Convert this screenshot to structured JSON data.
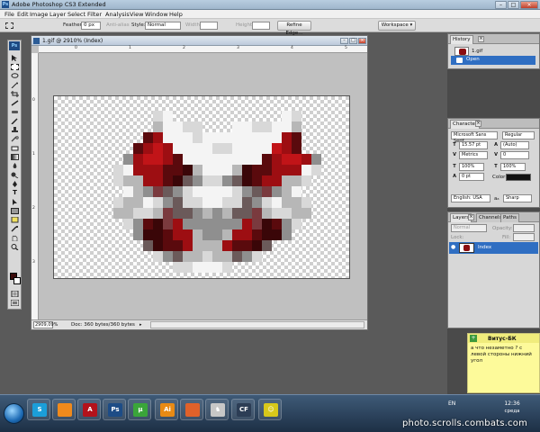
{
  "window": {
    "title": "Adobe Photoshop CS3 Extended",
    "controls": {
      "minimize": "–",
      "maximize": "□",
      "close": "×"
    }
  },
  "menu": [
    "File",
    "Edit",
    "Image",
    "Layer",
    "Select",
    "Filter",
    "Analysis",
    "View",
    "Window",
    "Help"
  ],
  "options_bar": {
    "feather_label": "Feather:",
    "feather_value": "0 px",
    "antialias_label": "Anti-alias",
    "style_label": "Style:",
    "style_value": "Normal",
    "width_label": "Width:",
    "height_label": "Height:",
    "refine_edge": "Refine Edge...",
    "workspace": "Workspace ▾"
  },
  "toolbox": {
    "logo": "Ps"
  },
  "document": {
    "title": "1.gif @ 2910% (Index)",
    "zoom": "2909,09%",
    "doc_info": "Doc: 360 bytes/360 bytes",
    "status_arrow": "▸"
  },
  "history_panel": {
    "tab": "History",
    "close": "×",
    "snapshot": "1.gif",
    "step": "Open"
  },
  "character_panel": {
    "tab": "Character",
    "close": "×",
    "font_family": "Microsoft Sans Serif",
    "font_style": "Regular",
    "font_size": "15.57 pt",
    "leading": "(Auto)",
    "kerning": "Metrics",
    "tracking": "0",
    "vscale": "100%",
    "hscale": "100%",
    "baseline": "0 pt",
    "color_label": "Color:",
    "language": "English: USA",
    "antialias": "Sharp",
    "aa_prefix": "aₐ"
  },
  "layers_panel": {
    "tabs": [
      "Layers",
      "Channels",
      "Paths"
    ],
    "close": "×",
    "blend_mode": "Normal",
    "opacity_label": "Opacity:",
    "lock_label": "Lock:",
    "fill_label": "Fill:",
    "layer_name": "Index"
  },
  "note": {
    "title": "Витус-БК",
    "body": "а что незаметно ? с левой стороны нижний угол"
  },
  "taskbar": {
    "lang": "EN",
    "time": "12:36",
    "day": "среда",
    "apps": [
      {
        "name": "skype",
        "glyph": "S",
        "color": "#1b9ed9"
      },
      {
        "name": "orange-blob",
        "glyph": "",
        "color": "#f08a1c"
      },
      {
        "name": "acrobat",
        "glyph": "A",
        "color": "#b3121b"
      },
      {
        "name": "photoshop",
        "glyph": "Ps",
        "color": "#1d4c86"
      },
      {
        "name": "utorrent",
        "glyph": "µ",
        "color": "#3aa53a"
      },
      {
        "name": "illustrator",
        "glyph": "Ai",
        "color": "#e88a14"
      },
      {
        "name": "firefox",
        "glyph": "",
        "color": "#e0612a"
      },
      {
        "name": "chess-game",
        "glyph": "♞",
        "color": "#c7c7c7"
      },
      {
        "name": "cf-app",
        "glyph": "CF",
        "color": "#2c3d55"
      },
      {
        "name": "game-app",
        "glyph": "☺",
        "color": "#d8c81a"
      }
    ]
  },
  "watermark": "photo.scrolls.combats.com",
  "colors": {
    "accent": "#2f6ec2",
    "dark_red": "#8b0d10",
    "note_bg": "#fdfa9a"
  }
}
